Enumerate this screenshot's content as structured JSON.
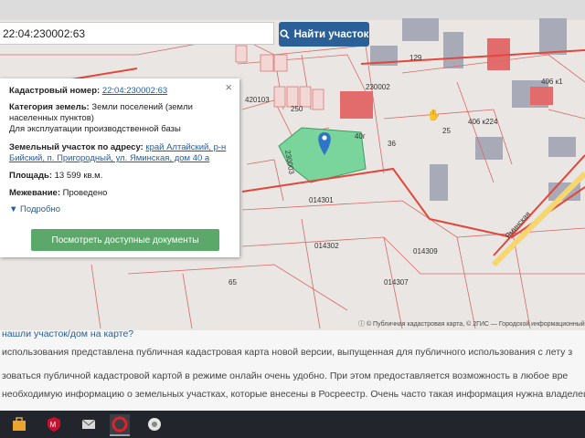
{
  "search": {
    "value": "22:04:230002:63",
    "button_label": "Найти участок"
  },
  "info": {
    "cad_label": "Кадастровый номер:",
    "cad_value": "22:04:230002:63",
    "cat_label": "Категория земель:",
    "cat_value_1": "Земли поселений (земли",
    "cat_value_2": "населенных пунктов)",
    "use_value": "Для эксплуатации производственной базы",
    "addr_label": "Земельный участок по адресу:",
    "addr_value_1": "край Алтайский, р-н",
    "addr_value_2": "Бийский, п. Пригородный, ул. Яминская, дом 40 а",
    "area_label": "Площадь:",
    "area_value": "13 599 кв.м.",
    "boundary_label": "Межевание:",
    "boundary_value": "Проведено",
    "more_label": "Подробно",
    "docs_button": "Посмотреть доступные документы"
  },
  "map_labels": {
    "l1": "420103",
    "l2": "230002",
    "l3": "014301",
    "l4": "014302",
    "l5": "014307",
    "l6": "129",
    "l7": "406 к1",
    "l8": "406 к224",
    "l9": "40г",
    "l10": "36",
    "l11": "25",
    "l12": "65",
    "l13": "014309",
    "l14": "Яминская",
    "l15": "250",
    "l16": "230003"
  },
  "attribution": "© Публичная кадастровая карта, © 2ГИС — Городской информационный",
  "bottom": {
    "q": "нашли участок/дом на карте?",
    "p1": "использования представлена публичная кадастровая карта новой версии, выпущенная для публичного использования с лету з",
    "p2": "зоваться публичной кадастровой картой в режиме онлайн очень удобно. При этом предоставляется возможность в любое вре",
    "p3": "необходимую информацию о земельных участках, которые внесены в Росреестр. Очень часто такая информация нужна владелец"
  },
  "colors": {
    "accent": "#2b5f97",
    "green_button": "#5ba86a",
    "parcel": "#79d59b",
    "boundary": "#e2473c"
  }
}
